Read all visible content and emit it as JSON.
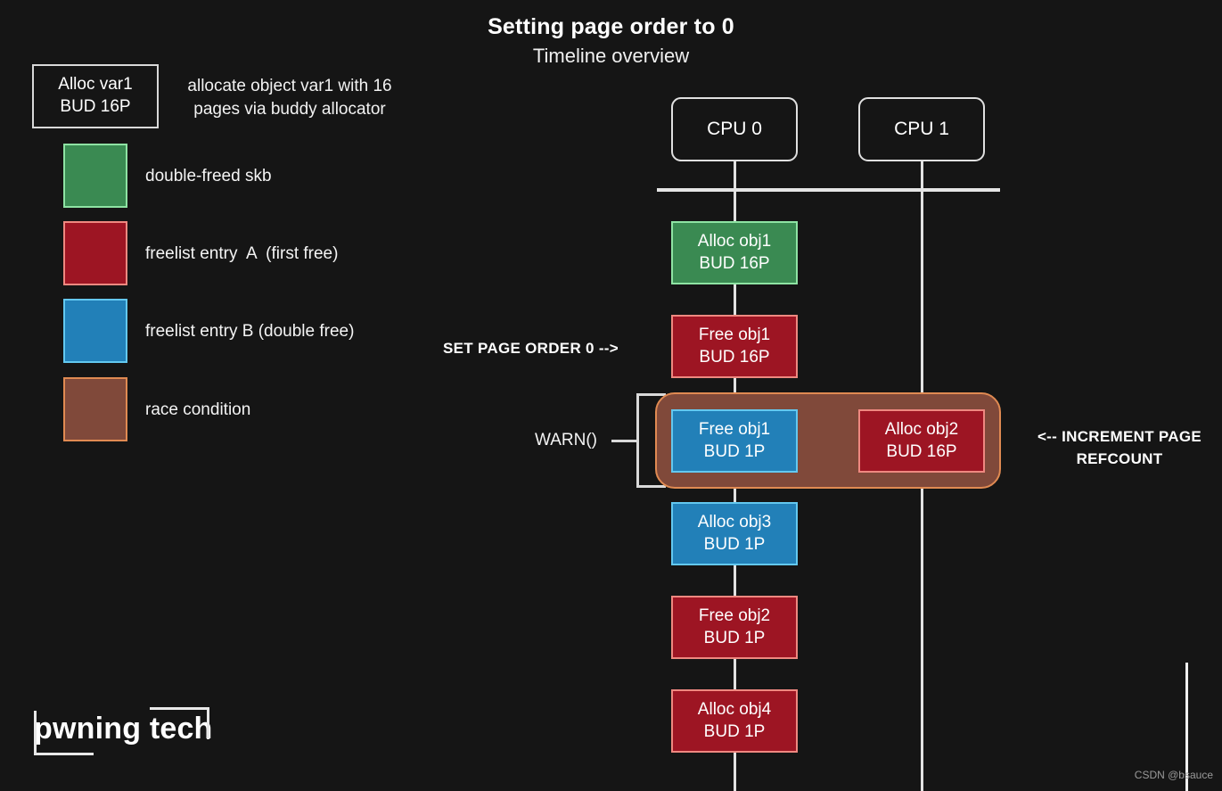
{
  "title": {
    "main": "Setting page order to 0",
    "sub": "Timeline overview"
  },
  "legend": {
    "sample_box": {
      "line1": "Alloc var1",
      "line2": "BUD 16P",
      "description": "allocate object var1 with 16 pages via buddy allocator"
    },
    "items": [
      {
        "label": "double-freed skb",
        "fill": "#3a8a52",
        "border": "#8ee3a3"
      },
      {
        "label": "freelist entry  A  (first free)",
        "fill": "#9d1523",
        "border": "#ef8880"
      },
      {
        "label": "freelist entry B (double free)",
        "fill": "#2280b8",
        "border": "#63c8f0"
      },
      {
        "label": "race condition",
        "fill": "#80493a",
        "border": "#e08a52"
      }
    ]
  },
  "timeline": {
    "cpus": [
      {
        "label": "CPU 0"
      },
      {
        "label": "CPU 1"
      }
    ],
    "events_cpu0": [
      {
        "line1": "Alloc obj1",
        "line2": "BUD 16P",
        "kind": "green"
      },
      {
        "line1": "Free obj1",
        "line2": "BUD 16P",
        "kind": "red"
      },
      {
        "line1": "Free obj1",
        "line2": "BUD 1P",
        "kind": "blue"
      },
      {
        "line1": "Alloc obj3",
        "line2": "BUD 1P",
        "kind": "blue"
      },
      {
        "line1": "Free obj2",
        "line2": "BUD 1P",
        "kind": "red"
      },
      {
        "line1": "Alloc obj4",
        "line2": "BUD 1P",
        "kind": "red"
      }
    ],
    "events_cpu1": [
      {
        "line1": "Alloc obj2",
        "line2": "BUD 16P",
        "kind": "red"
      }
    ]
  },
  "annotations": {
    "set_page_order": "SET PAGE ORDER 0 -->",
    "warn": "WARN()",
    "increment_refcount_line1": "<-- INCREMENT PAGE",
    "increment_refcount_line2": "REFCOUNT"
  },
  "logo": {
    "text": "pwning tech"
  },
  "watermark": "CSDN @bsauce",
  "colors": {
    "background": "#151515",
    "green_fill": "#3a8a52",
    "green_border": "#8ee3a3",
    "red_fill": "#9d1523",
    "red_border": "#ef8880",
    "blue_fill": "#2280b8",
    "blue_border": "#63c8f0",
    "brown_fill": "#80493a",
    "brown_border": "#e08a52",
    "line": "#e2e2e2"
  }
}
